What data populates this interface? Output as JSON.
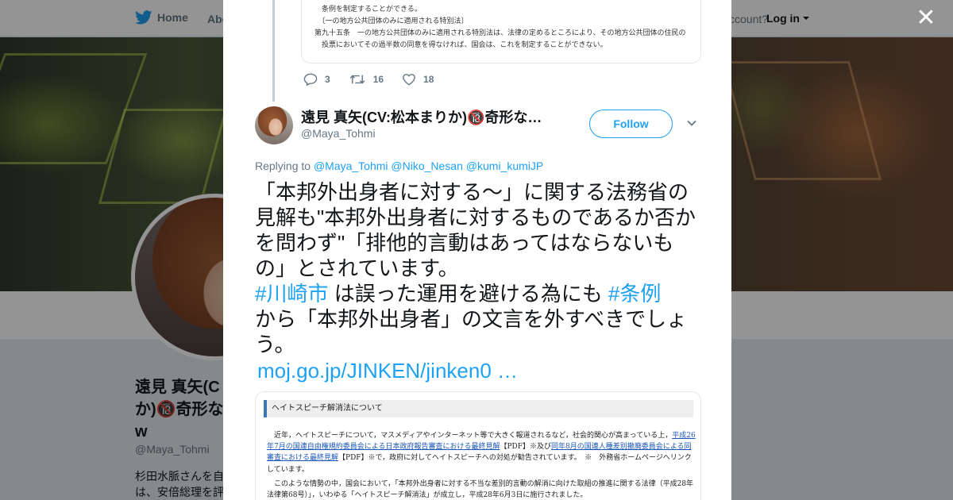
{
  "background": {
    "nav": {
      "home": "Home",
      "about": "Abo",
      "account_question": "ccount?",
      "login": "Log in"
    },
    "profile": {
      "name_lines": [
        "遠見 真矢(C",
        "か)🔞奇形な",
        "w"
      ],
      "handle": "@Maya_Tohmi",
      "bio_lines": [
        "杉田水脈さんを自",
        "は、安倍総理を評"
      ]
    }
  },
  "modal": {
    "close": "✕",
    "quoted_doc_lines": [
      "　条例を制定することができる。",
      "　〔一の地方公共団体のみに適用される特別法〕",
      "第九十五条　一の地方公共団体のみに適用される特別法は、法律の定めるところにより、その地方公共団体の住民の",
      "　投票においてその過半数の同意を得なければ、国会は、これを制定することができない。"
    ],
    "actions": {
      "reply_count": "3",
      "retweet_count": "16",
      "like_count": "18"
    },
    "author": {
      "name": "遠見 真矢(CV:松本まりか)🔞奇形な…",
      "handle": "@Maya_Tohmi",
      "follow_label": "Follow"
    },
    "replying": {
      "prefix": "Replying to",
      "m1": "@Maya_Tohmi",
      "m2": "@Niko_Nesan",
      "m3": "@kumi_kumiJP"
    },
    "tweet": {
      "line1": "「本邦外出身者に対する～」に関する法務省の見解も\"本邦外出身者に対するものであるか否かを問わず\"「排他的言動はあってはならないもの」とされています。",
      "tag1": "#川崎市",
      "mid": " は誤った運用を避ける為にも ",
      "tag2": "#条例",
      "tail": " から「本邦外出身者」の文言を外すべきでしょう。",
      "link": "moj.go.jp/JINKEN/jinken0 …"
    },
    "media": {
      "heading": "ヘイトスピーチ解消法について",
      "p1_a": "　近年，ヘイトスピーチについて，マスメディアやインターネット等で大きく報道されるなど，社会的関心が高まっている上，",
      "p1_link1": "平成26年7月の国連自由権規約委員会による日本政府報告審査における最終見解",
      "p1_b": "【PDF】※及び",
      "p1_link2": "同年8月の国連人種差別撤廃委員会による同審査における最終見解",
      "p1_c": "【PDF】※で，政府に対してヘイトスピーチへの対処が勧告されています。　※　外務省ホームページへリンクしています。",
      "p2": "　このような情勢の中，国会において，「本邦外出身者に対する不当な差別的言動の解消に向けた取組の推進に関する法律（平成28年法律第68号）」，いわゆる「ヘイトスピーチ解消法」が成立し，平成28年6月3日に施行されました。"
    }
  }
}
